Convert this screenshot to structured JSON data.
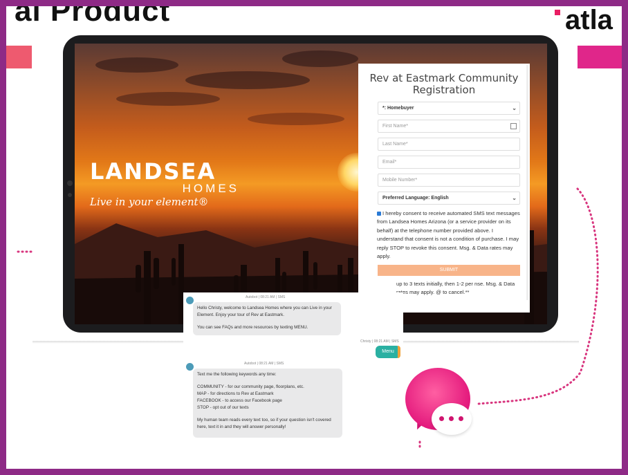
{
  "header": {
    "left_text": "al Product",
    "right_text": "atla"
  },
  "brand": {
    "name": "LANDSEA",
    "sub": "HOMES",
    "tagline": "Live in your element®"
  },
  "form": {
    "title": "Rev at Eastmark Community Registration",
    "type_select": "*: Homebuyer",
    "first_name_placeholder": "First Name*",
    "last_name_placeholder": "Last Name*",
    "email_placeholder": "Email*",
    "mobile_placeholder": "Mobile Number*",
    "language_select": "Preferred Language: English",
    "consent_text": "I hereby consent to receive automated SMS text messages from Landsea Homes Arizona (or a service provider on its behalf) at the telephone number provided above. I understand that consent is not a condition of purchase. I may reply STOP to revoke this consent. Msg. & Data rates may apply.",
    "submit_label": "SUBMIT",
    "after_text": "up to 3 texts initially, then 1-2 per nse. Msg. & Data rates may apply. @ to cancel.**"
  },
  "chat": {
    "msg1_meta": "Autobot | 08:21 AM | SMS",
    "msg1_text": "Hello Christy, welcome to Landsea Homes where you can Live in your Element. Enjoy your tour of Rev at Eastmark.",
    "msg1_text2": "You can see FAQs and more resources by texting MENU.",
    "reply_meta": "Christy | 08:21 AM | SMS",
    "reply_text": "Menu",
    "msg2_meta": "Autobot | 08:21 AM | SMS",
    "msg2_intro": "Text me the following keywords any time:",
    "msg2_items": [
      "COMMUNITY - for our community page, floorplans, etc.",
      "MAP - for directions to Rev at Eastmark",
      "FACEBOOK - to access our Facebook page",
      "STOP - opt out of our texts"
    ],
    "msg2_footer": "My human team reads every text too, so if your question isn't covered here, text it in and they will answer personally!"
  },
  "colors": {
    "frame": "#8e2a86",
    "accent_pink": "#e0268a",
    "accent_coral": "#ee5a6f",
    "submit": "#f8b489",
    "menu": "#2ab0a2"
  }
}
